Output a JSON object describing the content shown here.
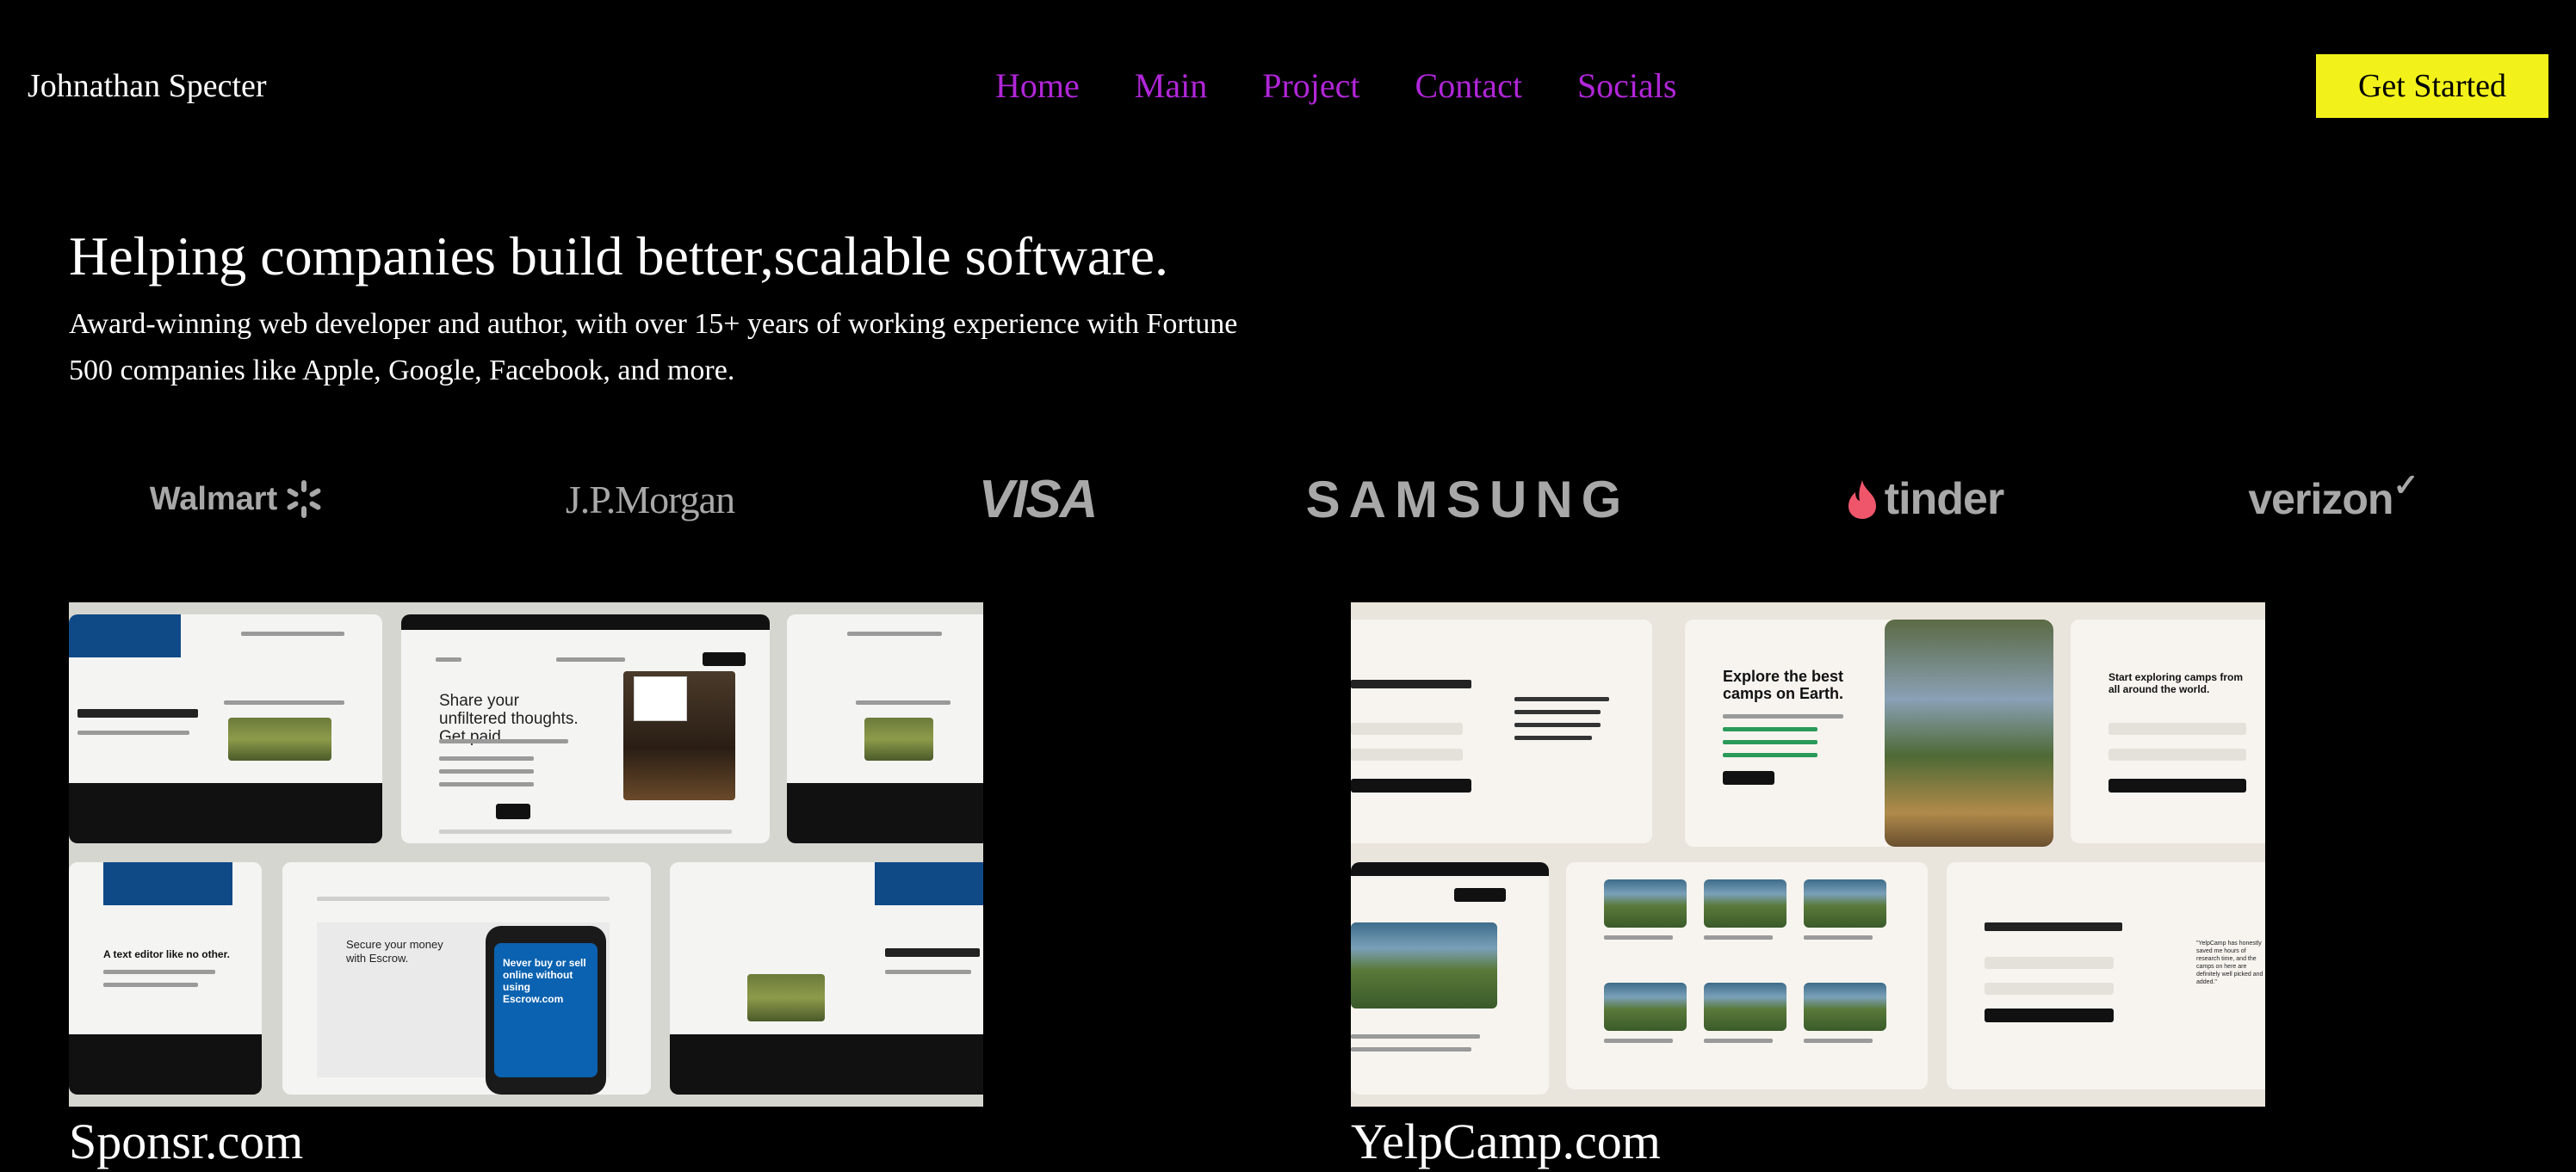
{
  "header": {
    "brand": "Johnathan Specter",
    "nav": [
      "Home",
      "Main",
      "Project",
      "Contact",
      "Socials"
    ],
    "cta_label": "Get Started",
    "accent_color": "#b026d8",
    "cta_color": "#f2f21a"
  },
  "hero": {
    "title": "Helping companies build better,scalable software.",
    "subtitle": "Award-winning web developer and author, with over 15+ years of working experience with Fortune 500 companies like Apple, Google, Facebook, and more."
  },
  "logos": {
    "walmart": "Walmart",
    "jpmorgan": "J.P.Morgan",
    "visa": "VISA",
    "samsung": "SAMSUNG",
    "tinder": "tinder",
    "verizon": "verizon"
  },
  "projects": [
    {
      "title": "Sponsr.com",
      "thumb": {
        "headline": "Share your unfiltered thoughts. Get paid.",
        "secure": "Secure your money with Escrow.",
        "never_buy": "Never buy or sell online without using Escrow.com",
        "editor": "A text editor like no other."
      }
    },
    {
      "title": "YelpCamp.com",
      "thumb": {
        "explore": "Explore the best camps on Earth.",
        "start": "Start exploring camps from all around the world.",
        "quote": "\"YelpCamp has honestly saved me hours of research time, and the camps on here are definitely well picked and added.\""
      }
    }
  ]
}
